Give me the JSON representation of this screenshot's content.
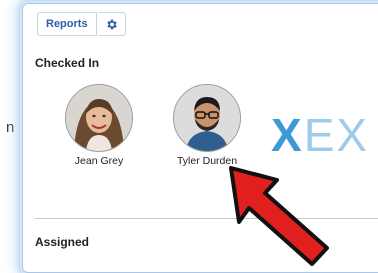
{
  "toolbar": {
    "reports_label": "Reports",
    "settings_icon": "gear-icon"
  },
  "sections": {
    "checked_in": "Checked In",
    "assigned": "Assigned"
  },
  "people": [
    {
      "name": "Jean Grey",
      "avatar_icon": "avatar-woman"
    },
    {
      "name": "Tyler Durden",
      "avatar_icon": "avatar-man"
    }
  ],
  "brand": {
    "x_letter": "X",
    "rest": "EX"
  },
  "left_fragment": "n",
  "colors": {
    "accent": "#2f5da8",
    "arrow_red": "#e21f1f",
    "brand_blue": "#3d9ad6"
  }
}
